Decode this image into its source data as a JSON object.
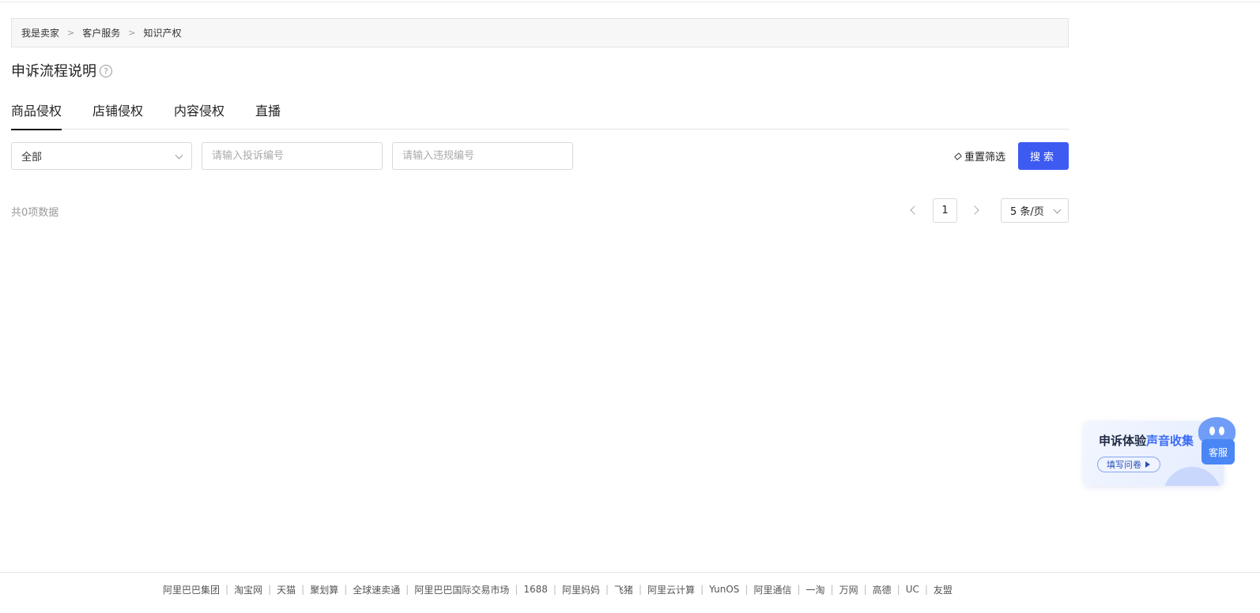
{
  "breadcrumb": [
    "我是卖家",
    "客户服务",
    "知识产权"
  ],
  "breadcrumb_separator": ">",
  "page_title": "申诉流程说明",
  "help_icon": "?",
  "tabs": [
    {
      "label": "商品侵权",
      "active": true
    },
    {
      "label": "店铺侵权",
      "active": false
    },
    {
      "label": "内容侵权",
      "active": false
    },
    {
      "label": "直播",
      "active": false
    }
  ],
  "filters": {
    "select_value": "全部",
    "complaint_placeholder": "请输入投诉编号",
    "violation_placeholder": "请输入违规编号",
    "reset_label": "重置筛选",
    "search_label": "搜索"
  },
  "list": {
    "total_text": "共0项数据",
    "current_page": "1",
    "page_size": "5 条/页"
  },
  "promo": {
    "title_prefix": "申诉体验",
    "title_highlight": "声音收集",
    "button_label": "填写问卷"
  },
  "service": {
    "label": "客服"
  },
  "footer_links": [
    "阿里巴巴集团",
    "淘宝网",
    "天猫",
    "聚划算",
    "全球速卖通",
    "阿里巴巴国际交易市场",
    "1688",
    "阿里妈妈",
    "飞猪",
    "阿里云计算",
    "YunOS",
    "阿里通信",
    "一淘",
    "万网",
    "高德",
    "UC",
    "友盟"
  ],
  "colors": {
    "primary": "#3d5af1",
    "tab_active_underline": "#111111"
  }
}
